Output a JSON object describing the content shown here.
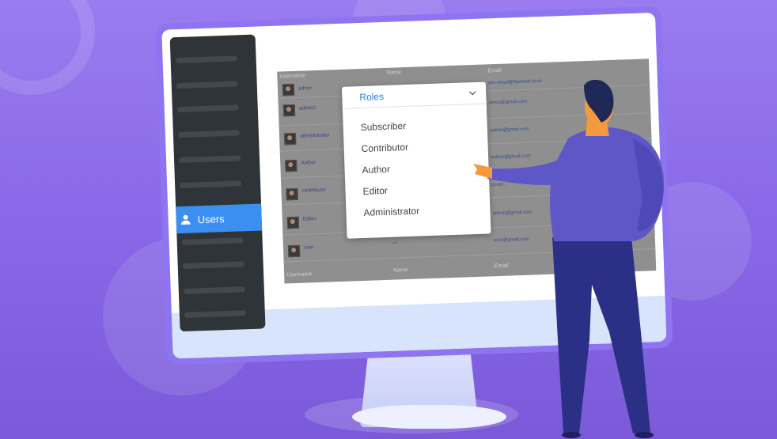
{
  "sidebar": {
    "active_item": "Users"
  },
  "table": {
    "header": {
      "username": "Username",
      "name": "Name",
      "email": "Email"
    },
    "footer": {
      "username": "Username",
      "name": "Name",
      "email": "Email"
    },
    "rows": [
      {
        "username": "admin",
        "email": "dev-email@flywheel.local"
      },
      {
        "username": "admin2",
        "email": "demo@gmail.com"
      },
      {
        "username": "administrator",
        "email": "admin@gmail.com"
      },
      {
        "username": "Author",
        "email": "author@gmail.com"
      },
      {
        "username": "contributor",
        "email": "contri..."
      },
      {
        "username": "Editor",
        "email": "admin@gmail.com"
      },
      {
        "username": "user",
        "name": "—",
        "email": "user@gmail.com"
      }
    ]
  },
  "roles_dropdown": {
    "selected": "Roles",
    "options": [
      "Subscriber",
      "Contributor",
      "Author",
      "Editor",
      "Administrator"
    ]
  },
  "colors": {
    "accent": "#3b8ff0",
    "background": "#8a6ae8",
    "sidebar": "#2f3438"
  }
}
